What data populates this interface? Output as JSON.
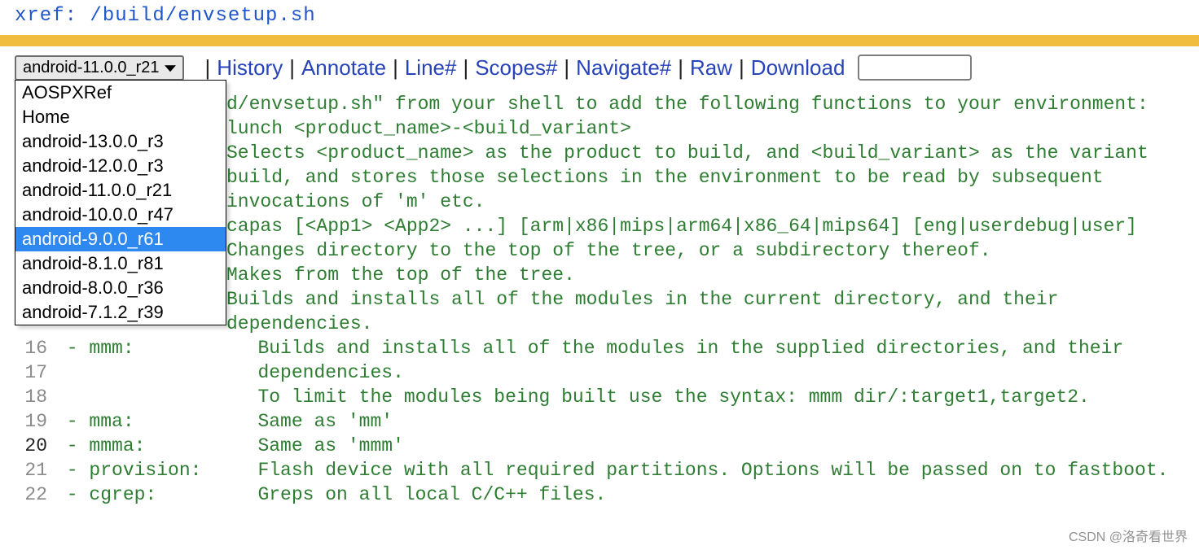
{
  "header": {
    "xref_label": "xref",
    "path": "/build/envsetup.sh"
  },
  "dropdown": {
    "selected": "android-11.0.0_r21",
    "options": [
      {
        "label": "AOSPXRef",
        "highlighted": false
      },
      {
        "label": "Home",
        "highlighted": false
      },
      {
        "label": "android-13.0.0_r3",
        "highlighted": false
      },
      {
        "label": "android-12.0.0_r3",
        "highlighted": false
      },
      {
        "label": "android-11.0.0_r21",
        "highlighted": false
      },
      {
        "label": "android-10.0.0_r47",
        "highlighted": false
      },
      {
        "label": "android-9.0.0_r61",
        "highlighted": true
      },
      {
        "label": "android-8.1.0_r81",
        "highlighted": false
      },
      {
        "label": "android-8.0.0_r36",
        "highlighted": false
      },
      {
        "label": "android-7.1.2_r39",
        "highlighted": false
      }
    ]
  },
  "toolbar": {
    "history": "History",
    "annotate": "Annotate",
    "lineno": "Line#",
    "scopes": "Scopes#",
    "navigate": "Navigate#",
    "raw": "Raw",
    "download": "Download"
  },
  "search": {
    "value": ""
  },
  "code": {
    "lines": [
      {
        "n": "",
        "black": false,
        "text": "d/envsetup.sh\" from your shell to add the following functions to your environment:"
      },
      {
        "n": "",
        "black": false,
        "text": "lunch <product_name>-<build_variant>"
      },
      {
        "n": "",
        "black": false,
        "text": "Selects <product_name> as the product to build, and <build_variant> as the variant "
      },
      {
        "n": "",
        "black": false,
        "text": "build, and stores those selections in the environment to be read by subsequent"
      },
      {
        "n": "",
        "black": false,
        "text": "invocations of 'm' etc."
      },
      {
        "n": "",
        "black": false,
        "text": "capas [<App1> <App2> ...] [arm|x86|mips|arm64|x86_64|mips64] [eng|userdebug|user]"
      },
      {
        "n": "",
        "black": false,
        "text": "Changes directory to the top of the tree, or a subdirectory thereof."
      },
      {
        "n": "",
        "black": false,
        "text": "Makes from the top of the tree."
      },
      {
        "n": "",
        "black": false,
        "text": "Builds and installs all of the modules in the current directory, and their"
      },
      {
        "n": "",
        "black": false,
        "text": "dependencies."
      },
      {
        "n": "16",
        "black": false,
        "cmd": "mmm",
        "text": "Builds and installs all of the modules in the supplied directories, and their"
      },
      {
        "n": "17",
        "black": false,
        "cmd": "",
        "text": "dependencies."
      },
      {
        "n": "18",
        "black": false,
        "cmd": "",
        "text": "To limit the modules being built use the syntax: mmm dir/:target1,target2."
      },
      {
        "n": "19",
        "black": false,
        "cmd": "mma",
        "text": "Same as 'mm'"
      },
      {
        "n": "20",
        "black": true,
        "cmd": "mmma",
        "text": "Same as 'mmm'"
      },
      {
        "n": "21",
        "black": false,
        "cmd": "provision",
        "text": "Flash device with all required partitions. Options will be passed on to fastboot."
      },
      {
        "n": "22",
        "black": false,
        "cmd": "cgrep",
        "text": "Greps on all local C/C++ files."
      }
    ]
  },
  "watermark": "CSDN @洛奇看世界"
}
